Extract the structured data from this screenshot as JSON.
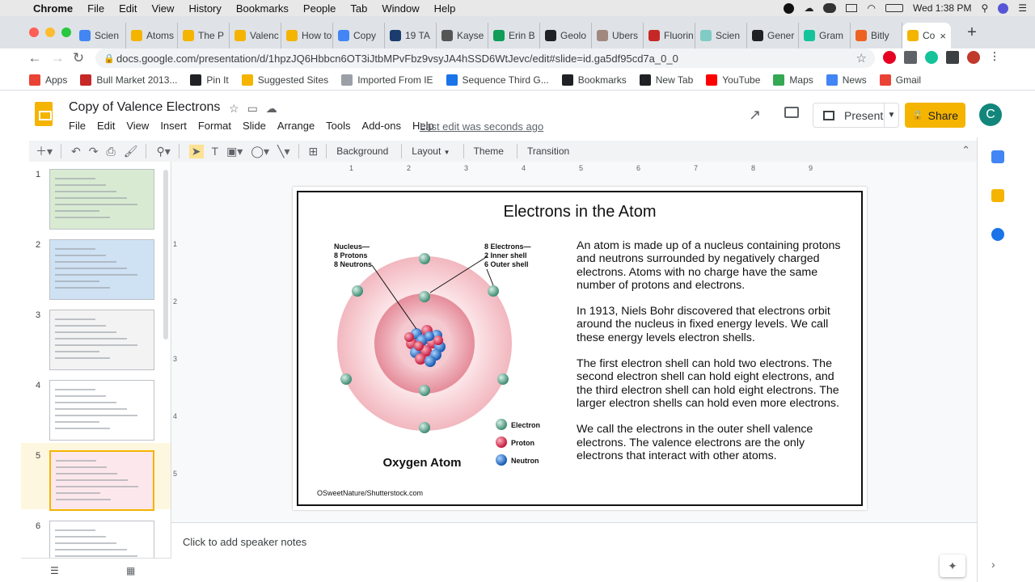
{
  "macbar": {
    "app_name": "Chrome",
    "menu": [
      "File",
      "Edit",
      "View",
      "History",
      "Bookmarks",
      "People",
      "Tab",
      "Window",
      "Help"
    ],
    "clock": "Wed 1:38 PM"
  },
  "tabs": [
    {
      "label": "Scien",
      "color": "#4285f4"
    },
    {
      "label": "Atoms",
      "color": "#f4b400"
    },
    {
      "label": "The P",
      "color": "#f4b400"
    },
    {
      "label": "Valenc",
      "color": "#f4b400"
    },
    {
      "label": "How to",
      "color": "#f4b400"
    },
    {
      "label": "Copy",
      "color": "#4285f4"
    },
    {
      "label": "19 TA",
      "color": "#1a3c6e"
    },
    {
      "label": "Kayse",
      "color": "#555555"
    },
    {
      "label": "Erin B",
      "color": "#0f9d58"
    },
    {
      "label": "Geolo",
      "color": "#202124"
    },
    {
      "label": "Ubers",
      "color": "#a1887f"
    },
    {
      "label": "Fluorin",
      "color": "#c62828"
    },
    {
      "label": "Scien",
      "color": "#80cbc4"
    },
    {
      "label": "Gener",
      "color": "#202124"
    },
    {
      "label": "Gram",
      "color": "#15c39a"
    },
    {
      "label": "Bitly",
      "color": "#ee6123"
    },
    {
      "label": "Co",
      "color": "#f4b400",
      "active": true
    }
  ],
  "address": {
    "url": "docs.google.com/presentation/d/1hpzJQ6Hbbcn6OT3iJtbMPvFbz9vsyJA4hSSD6WtJevc/edit#slide=id.ga5df95cd7a_0_0"
  },
  "bookmarks": [
    {
      "label": "Apps",
      "color": "#ea4335"
    },
    {
      "label": "Bull Market 2013...",
      "color": "#c62828"
    },
    {
      "label": "Pin It",
      "color": "#202124"
    },
    {
      "label": "Suggested Sites",
      "color": "#f4b400"
    },
    {
      "label": "Imported From IE",
      "color": "#9aa0a6"
    },
    {
      "label": "Sequence Third G...",
      "color": "#1a73e8"
    },
    {
      "label": "Bookmarks",
      "color": "#202124"
    },
    {
      "label": "New Tab",
      "color": "#202124"
    },
    {
      "label": "YouTube",
      "color": "#ff0000"
    },
    {
      "label": "Maps",
      "color": "#34a853"
    },
    {
      "label": "News",
      "color": "#4285f4"
    },
    {
      "label": "Gmail",
      "color": "#ea4335"
    }
  ],
  "doc": {
    "title": "Copy of Valence Electrons",
    "menu": [
      "File",
      "Edit",
      "View",
      "Insert",
      "Format",
      "Slide",
      "Arrange",
      "Tools",
      "Add-ons",
      "Help"
    ],
    "last_edit": "Last edit was seconds ago",
    "present_label": "Present",
    "share_label": "Share",
    "avatar_letter": "C"
  },
  "toolbar": {
    "background": "Background",
    "layout": "Layout",
    "theme": "Theme",
    "transition": "Transition"
  },
  "filmstrip": {
    "slides": [
      "1",
      "2",
      "3",
      "4",
      "5",
      "6"
    ],
    "selected": "5"
  },
  "slide": {
    "title": "Electrons in the Atom",
    "label_nucleus": "Nucleus—",
    "label_protons": "8 Protons",
    "label_neutrons": "8 Neutrons",
    "label_electrons": "8 Electrons—",
    "label_inner": "2 Inner shell",
    "label_outer": "6 Outer shell",
    "legend_electron": "Electron",
    "legend_proton": "Proton",
    "legend_neutron": "Neutron",
    "atom_caption": "Oxygen Atom",
    "credit": "OSweetNature/Shutterstock.com",
    "paragraphs": [
      "An atom is made up of a nucleus containing protons and neutrons surrounded by negatively charged electrons. Atoms with no charge have the same number of protons and electrons.",
      "In 1913, Niels Bohr discovered that electrons orbit around the nucleus in fixed energy levels. We call these energy levels electron shells.",
      "The first electron shell can hold two electrons. The second electron shell can hold eight electrons, and the third electron shell can hold eight electrons. The larger electron shells can hold even more electrons.",
      "We call the electrons in the outer shell valence electrons. The valence electrons are the only electrons that interact with other atoms."
    ]
  },
  "ruler_top": [
    "1",
    "2",
    "3",
    "4",
    "5",
    "6",
    "7",
    "8",
    "9"
  ],
  "ruler_left": [
    "1",
    "2",
    "3",
    "4",
    "5"
  ],
  "notes": {
    "placeholder": "Click to add speaker notes"
  }
}
